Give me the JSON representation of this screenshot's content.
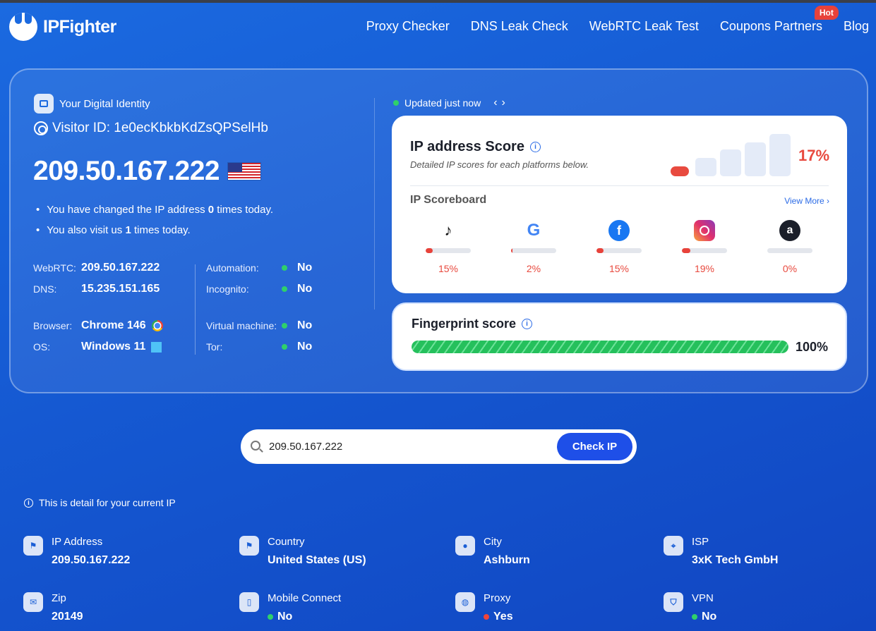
{
  "header": {
    "brand": "IPFighter",
    "nav": [
      "Proxy Checker",
      "DNS Leak Check",
      "WebRTC Leak Test",
      "Coupons Partners",
      "Blog"
    ],
    "hot_badge": "Hot"
  },
  "identity": {
    "section_label": "Your Digital Identity",
    "visitor_id": "Visitor ID: 1e0ecKbkbKdZsQPSelHb",
    "ip": "209.50.167.222",
    "bullets": [
      {
        "pre": "You have changed the IP address ",
        "count": "0",
        "post": " times today."
      },
      {
        "pre": "You also visit us ",
        "count": "1",
        "post": " times today."
      }
    ],
    "left": [
      {
        "label": "WebRTC:",
        "value": "209.50.167.222"
      },
      {
        "label": "DNS:",
        "value": "15.235.151.165"
      },
      {
        "label": "Browser:",
        "value": "Chrome 146"
      },
      {
        "label": "OS:",
        "value": "Windows 11"
      }
    ],
    "right": [
      {
        "label": "Automation:",
        "value": "No"
      },
      {
        "label": "Incognito:",
        "value": "No"
      },
      {
        "label": "Virtual machine:",
        "value": "No"
      },
      {
        "label": "Tor:",
        "value": "No"
      }
    ]
  },
  "updated": "Updated just now",
  "ip_score": {
    "title": "IP address Score",
    "subtitle": "Detailed IP scores for each platforms below.",
    "percent": "17%",
    "level": 0.17,
    "scoreboard_title": "IP Scoreboard",
    "view_more": "View More ›",
    "platforms": [
      {
        "icon": "tiktok-icon",
        "value": "15%",
        "level": 0.15
      },
      {
        "icon": "google-icon",
        "value": "2%",
        "level": 0.02
      },
      {
        "icon": "facebook-icon",
        "value": "15%",
        "level": 0.15
      },
      {
        "icon": "instagram-icon",
        "value": "19%",
        "level": 0.19
      },
      {
        "icon": "amazon-icon",
        "value": "0%",
        "level": 0.0
      }
    ]
  },
  "fingerprint": {
    "title": "Fingerprint score",
    "percent": "100%",
    "level": 1.0
  },
  "search": {
    "value": "209.50.167.222",
    "button": "Check IP"
  },
  "detail_note": "This is detail for your current IP",
  "details": [
    {
      "label": "IP Address",
      "value": "209.50.167.222",
      "icon": "flag-icon"
    },
    {
      "label": "Country",
      "value": "United States (US)",
      "icon": "flag-icon"
    },
    {
      "label": "City",
      "value": "Ashburn",
      "icon": "location-pin-icon"
    },
    {
      "label": "ISP",
      "value": "3xK Tech GmbH",
      "icon": "satellite-icon"
    },
    {
      "label": "Zip",
      "value": "20149",
      "icon": "mailbox-icon"
    },
    {
      "label": "Mobile Connect",
      "value": "No",
      "icon": "mobile-icon",
      "dot": "green"
    },
    {
      "label": "Proxy",
      "value": "Yes",
      "icon": "globe-icon",
      "dot": "red"
    },
    {
      "label": "VPN",
      "value": "No",
      "icon": "shield-icon",
      "dot": "green"
    }
  ],
  "colors": {
    "accent": "#1e4fe8",
    "danger": "#e84a3f",
    "ok": "#2fd06b"
  }
}
